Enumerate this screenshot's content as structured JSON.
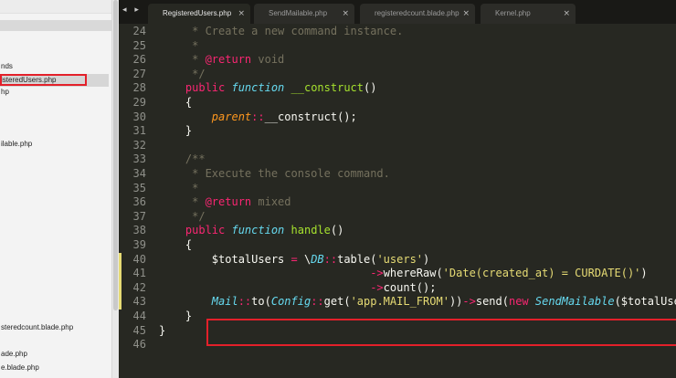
{
  "sidebar": {
    "items": [
      {
        "label": "nds",
        "top": 0
      },
      {
        "label": "isteredUsers.php",
        "selected": true
      },
      {
        "label": "hp"
      },
      {
        "label": "ilable.php"
      },
      {
        "label": "steredcount.blade.php"
      },
      {
        "label": "ade.php"
      },
      {
        "label": "e.blade.php"
      }
    ]
  },
  "tabs": [
    {
      "label": "RegisteredUsers.php",
      "active": true,
      "close": "×"
    },
    {
      "label": "SendMailable.php",
      "close": "×"
    },
    {
      "label": "registeredcount.blade.php",
      "close": "×"
    },
    {
      "label": "Kernel.php",
      "close": "×"
    }
  ],
  "nav": {
    "arrows": "◂ ▸"
  },
  "editor": {
    "line_numbers": [
      "24",
      "25",
      "26",
      "27",
      "28",
      "29",
      "30",
      "31",
      "32",
      "33",
      "34",
      "35",
      "36",
      "37",
      "38",
      "39",
      "40",
      "41",
      "42",
      "43",
      "44",
      "45",
      "46"
    ],
    "lines": [
      [
        {
          "t": "cm",
          "v": "     * Create a new command instance."
        }
      ],
      [
        {
          "t": "cm",
          "v": "     *"
        }
      ],
      [
        {
          "t": "cm",
          "v": "     * "
        },
        {
          "t": "kw",
          "v": "@return"
        },
        {
          "t": "cm",
          "v": " void"
        }
      ],
      [
        {
          "t": "cm",
          "v": "     */"
        }
      ],
      [
        {
          "t": "kw",
          "v": "    public "
        },
        {
          "t": "ty",
          "v": "function"
        },
        {
          "t": "pl",
          "v": " "
        },
        {
          "t": "fn",
          "v": "__construct"
        },
        {
          "t": "pl",
          "v": "()"
        }
      ],
      [
        {
          "t": "pl",
          "v": "    {"
        }
      ],
      [
        {
          "t": "pl",
          "v": "        "
        },
        {
          "t": "sp",
          "v": "parent"
        },
        {
          "t": "kw",
          "v": "::"
        },
        {
          "t": "pl",
          "v": "__construct();"
        }
      ],
      [
        {
          "t": "pl",
          "v": "    }"
        }
      ],
      [
        {
          "t": "pl",
          "v": ""
        }
      ],
      [
        {
          "t": "cm",
          "v": "    /**"
        }
      ],
      [
        {
          "t": "cm",
          "v": "     * Execute the console command."
        }
      ],
      [
        {
          "t": "cm",
          "v": "     *"
        }
      ],
      [
        {
          "t": "cm",
          "v": "     * "
        },
        {
          "t": "kw",
          "v": "@return"
        },
        {
          "t": "cm",
          "v": " mixed"
        }
      ],
      [
        {
          "t": "cm",
          "v": "     */"
        }
      ],
      [
        {
          "t": "kw",
          "v": "    public "
        },
        {
          "t": "ty",
          "v": "function"
        },
        {
          "t": "pl",
          "v": " "
        },
        {
          "t": "fn",
          "v": "handle"
        },
        {
          "t": "pl",
          "v": "()"
        }
      ],
      [
        {
          "t": "pl",
          "v": "    {"
        }
      ],
      [
        {
          "t": "pl",
          "v": "        $totalUsers "
        },
        {
          "t": "kw",
          "v": "="
        },
        {
          "t": "pl",
          "v": " \\"
        },
        {
          "t": "ty",
          "v": "DB"
        },
        {
          "t": "kw",
          "v": "::"
        },
        {
          "t": "pl",
          "v": "table("
        },
        {
          "t": "st",
          "v": "'users'"
        },
        {
          "t": "pl",
          "v": ")"
        }
      ],
      [
        {
          "t": "pl",
          "v": "                                "
        },
        {
          "t": "kw",
          "v": "->"
        },
        {
          "t": "pl",
          "v": "whereRaw("
        },
        {
          "t": "st",
          "v": "'Date(created_at) = CURDATE()'"
        },
        {
          "t": "pl",
          "v": ")"
        }
      ],
      [
        {
          "t": "pl",
          "v": "                                "
        },
        {
          "t": "kw",
          "v": "->"
        },
        {
          "t": "pl",
          "v": "count();"
        }
      ],
      [
        {
          "t": "pl",
          "v": "        "
        },
        {
          "t": "ty",
          "v": "Mail"
        },
        {
          "t": "kw",
          "v": "::"
        },
        {
          "t": "pl",
          "v": "to("
        },
        {
          "t": "ty",
          "v": "Config"
        },
        {
          "t": "kw",
          "v": "::"
        },
        {
          "t": "pl",
          "v": "get("
        },
        {
          "t": "st",
          "v": "'app.MAIL_FROM'"
        },
        {
          "t": "pl",
          "v": "))"
        },
        {
          "t": "kw",
          "v": "->"
        },
        {
          "t": "pl",
          "v": "send("
        },
        {
          "t": "kw",
          "v": "new "
        },
        {
          "t": "ty",
          "v": "SendMailable"
        },
        {
          "t": "pl",
          "v": "($totalUsers));"
        }
      ],
      [
        {
          "t": "pl",
          "v": "    }"
        }
      ],
      [
        {
          "t": "pl",
          "v": "}"
        }
      ],
      [
        {
          "t": "pl",
          "v": ""
        }
      ]
    ],
    "modified_lines": [
      "40",
      "41",
      "42",
      "43"
    ]
  },
  "colors": {
    "background": "#272822",
    "keyword": "#f92672",
    "function": "#a6e22e",
    "string": "#e6db74",
    "comment": "#75715e",
    "type": "#66d9ef",
    "highlight_box": "#e3202a"
  }
}
